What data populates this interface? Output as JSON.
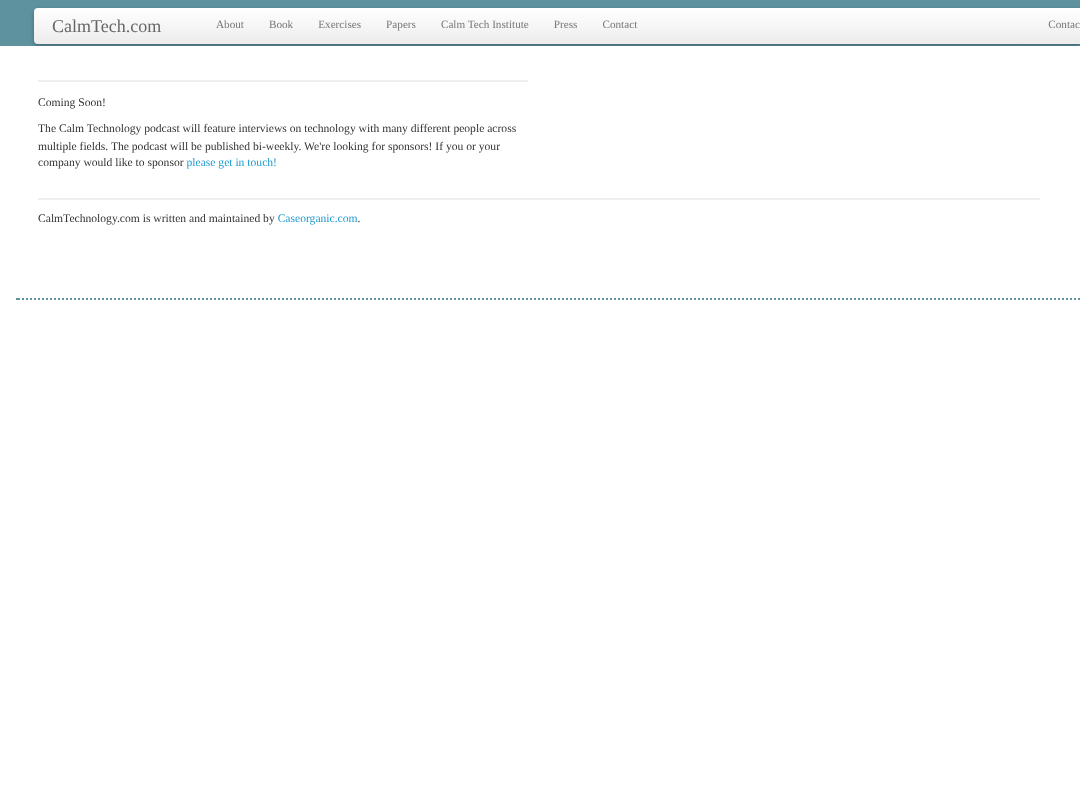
{
  "navbar": {
    "brand": "CalmTech.com",
    "links": [
      "About",
      "Book",
      "Exercises",
      "Papers",
      "Calm Tech Institute",
      "Press",
      "Contact"
    ],
    "right_link": "Contac"
  },
  "section": {
    "heading": "Coming Soon!",
    "paragraph": "The Calm Technology podcast will feature interviews on technology with many different people across multiple fields. The podcast will be published bi-weekly. We're looking for sponsors! If you or your company would like to sponsor ",
    "paragraph_link": "please get in touch!"
  },
  "footer": {
    "text": "CalmTechnology.com is written and maintained by ",
    "link": "Caseorganic.com",
    "suffix": "."
  }
}
